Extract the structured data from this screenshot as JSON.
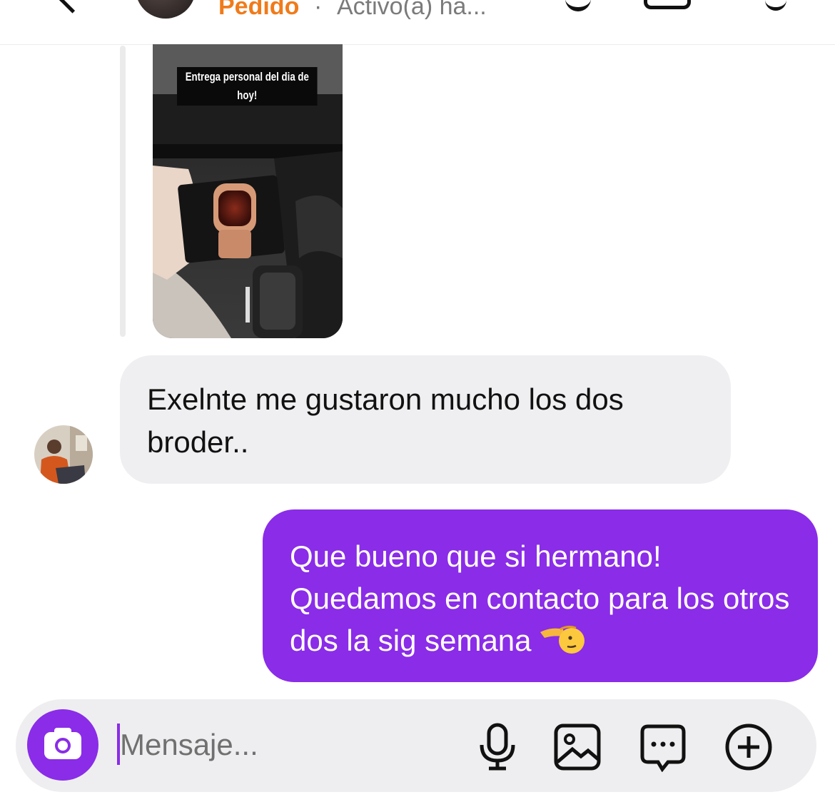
{
  "header": {
    "name": "Pedido",
    "separator": "·",
    "status": "Activo(a) ha..."
  },
  "story": {
    "caption": "Entrega personal del dia de hoy!"
  },
  "messages": [
    {
      "direction": "incoming",
      "text": "Exelnte me gustaron mucho los dos broder.."
    },
    {
      "direction": "outgoing",
      "text": "Que bueno que si hermano! Quedamos en contacto para los otros dos la sig semana"
    }
  ],
  "composer": {
    "placeholder": "Mensaje..."
  },
  "colors": {
    "accent": "#8a2ce8",
    "name": "#f07b1a",
    "incoming_bubble": "#efeff1"
  }
}
